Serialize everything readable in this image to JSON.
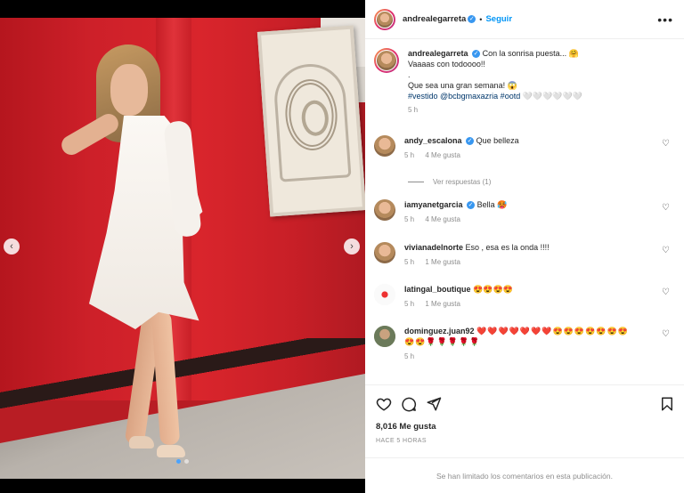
{
  "header": {
    "username": "andrealegarreta",
    "separator": "•",
    "follow_label": "Seguir",
    "more_glyph": "•••"
  },
  "caption": {
    "username": "andrealegarreta",
    "line1": "Con la sonrisa puesta... 🤗",
    "line2": "Vaaaas con todoooo!!",
    "line3": ".",
    "line4": "Que sea una gran semana! 😱",
    "tags": "#vestido @bcbgmaxazria #ootd 🤍🤍🤍🤍🤍🤍",
    "time": "5 h"
  },
  "comments": [
    {
      "username": "andy_escalona",
      "verified": true,
      "text": "Que belleza",
      "time": "5 h",
      "likes": "4 Me gusta"
    },
    {
      "username": "iamyanetgarcia",
      "verified": true,
      "text": "Bella 🥵",
      "time": "5 h",
      "likes": "4 Me gusta"
    },
    {
      "username": "vivianadelnorte",
      "verified": false,
      "text": "Eso , esa es la onda !!!!",
      "time": "5 h",
      "likes": "1 Me gusta"
    },
    {
      "username": "latingal_boutique",
      "verified": false,
      "text": "😍😍😍😍",
      "time": "5 h",
      "likes": "1 Me gusta"
    },
    {
      "username": "dominguez.juan92",
      "verified": false,
      "text": "❤️❤️❤️❤️❤️❤️❤️😍😍😍😍😍😍😍",
      "text2": "😍😍🌹🌹🌹🌹🌹",
      "time": "5 h",
      "likes": ""
    }
  ],
  "replies_label": "Ver respuestas (1)",
  "likes_count": "8,016 Me gusta",
  "posted_ago": "HACE 5 HORAS",
  "comments_limited": "Se han limitado los comentarios en esta publicación.",
  "icons": [
    "heart-icon",
    "comment-icon",
    "share-icon",
    "bookmark-icon",
    "chevron-left-icon",
    "chevron-right-icon",
    "verified-badge-icon"
  ],
  "colors": {
    "accent": "#0095f6",
    "verified": "#3897f0",
    "wall": "#d9252c",
    "muted": "#8e8e8e"
  },
  "carousel": {
    "slides": 2,
    "active": 1
  }
}
